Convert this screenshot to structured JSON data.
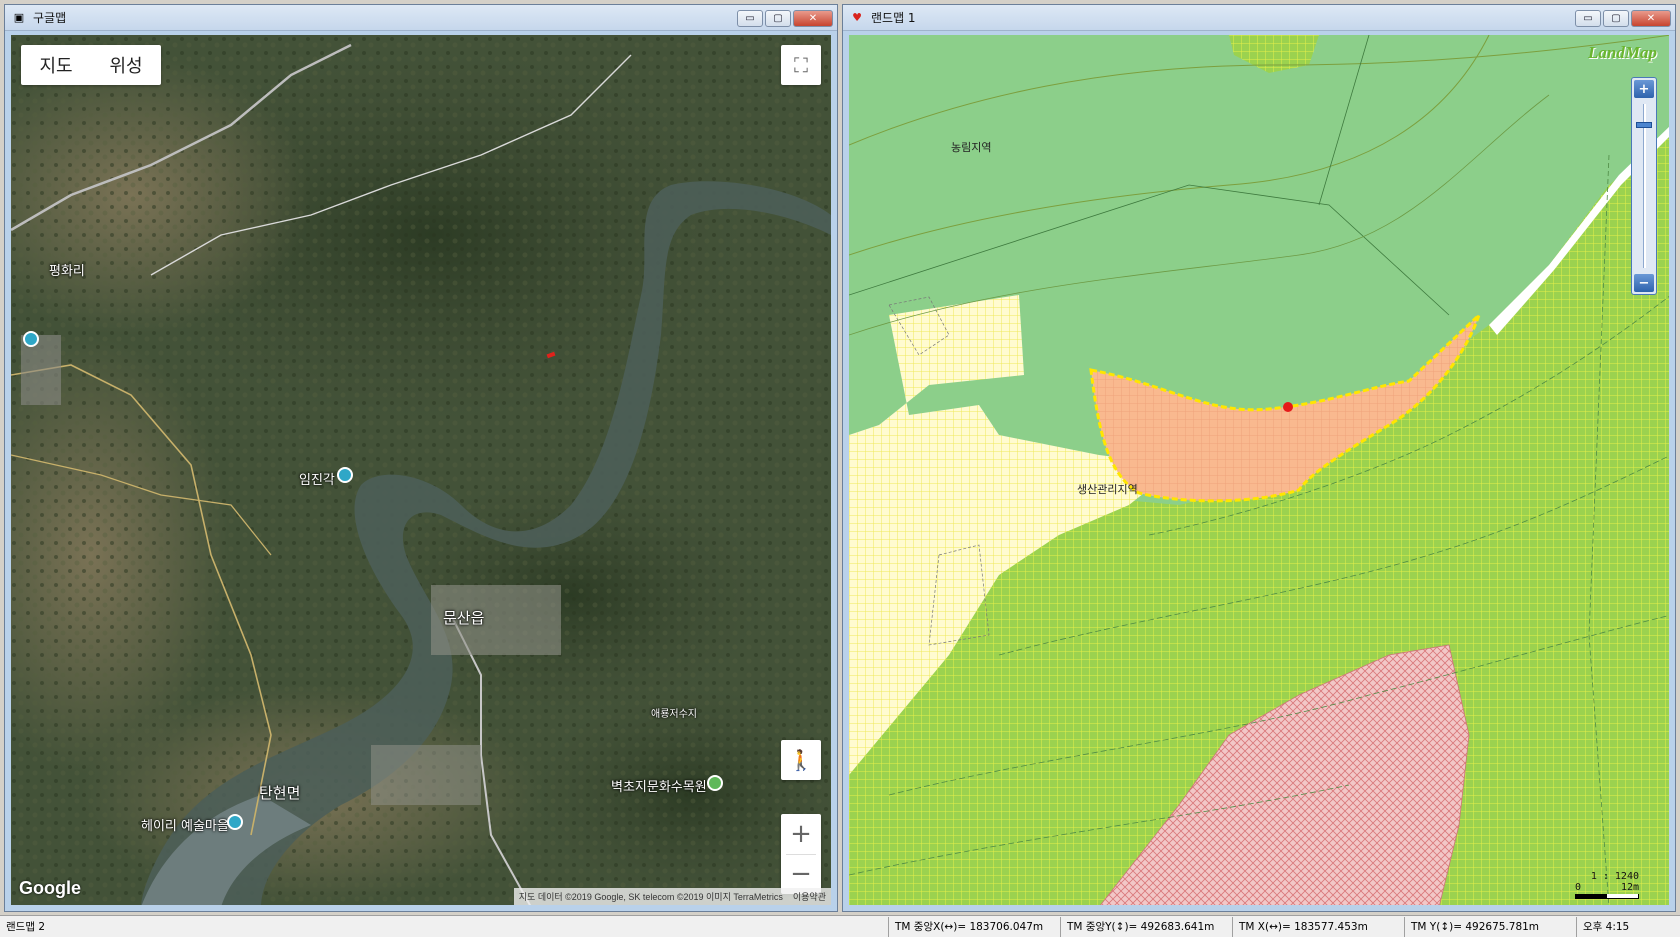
{
  "left_window": {
    "title": "구글맵",
    "map_type": {
      "map": "지도",
      "satellite": "위성"
    },
    "places": {
      "pyeonghwari": "평화리",
      "imjingak": "임진각",
      "munsaneup": "문산읍",
      "tanhyeonmyeon": "탄현면",
      "heyri": "헤이리 예술마을",
      "reservoir": "애룡저수지",
      "arboretum": "벽초지문화수목원"
    },
    "logo": "Google",
    "copyright": "지도 데이터 ©2019 Google, SK telecom ©2019 이미지 TerraMetrics",
    "terms": "이용약관",
    "icons": {
      "fullscreen": "⛶",
      "pegman": "🚶",
      "zoom_in": "+",
      "zoom_out": "−"
    }
  },
  "right_window": {
    "title": "랜드맵 1",
    "logo": "LandMap",
    "labels": {
      "forest": "농림지역",
      "production": "생산관리지역"
    },
    "zoom": {
      "in": "+",
      "out": "−"
    },
    "scale": {
      "ratio": "1 : 1240",
      "zero": "0",
      "distance": "12m"
    }
  },
  "window_buttons": {
    "minimize": "▭",
    "maximize": "▢",
    "close": "✕"
  },
  "status": {
    "name": "랜드맵 2",
    "tm_center_x": "TM 중앙X(↔)= 183706.047m",
    "tm_center_y": "TM 중앙Y(↕)= 492683.641m",
    "tm_x": "TM X(↔)= 183577.453m",
    "tm_y": "TM Y(↕)= 492675.781m",
    "clock": "오후 4:15"
  },
  "colors": {
    "forest_green": "#8ccf8a",
    "production_green": "#9bd24f",
    "planning_yellow": "#fffbd0",
    "selected_orange": "#f9b98f",
    "conservation_red": "#f2c7c7"
  }
}
